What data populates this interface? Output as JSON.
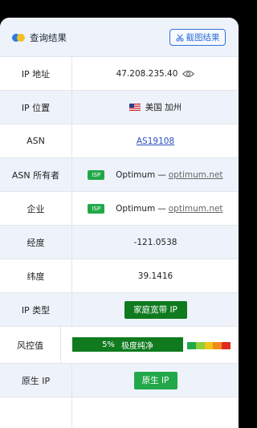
{
  "header": {
    "title": "查询结果",
    "screenshot_label": "截图结果"
  },
  "rows": {
    "ip_address": {
      "label": "IP 地址",
      "value": "47.208.235.40"
    },
    "ip_location": {
      "label": "IP 位置",
      "value": "美国 加州"
    },
    "asn": {
      "label": "ASN",
      "value": "AS19108"
    },
    "asn_owner": {
      "label": "ASN 所有者",
      "badge": "ISP",
      "name": "Optimum",
      "dash": "—",
      "domain": "optimum.net"
    },
    "company": {
      "label": "企业",
      "badge": "ISP",
      "name": "Optimum",
      "dash": "—",
      "domain": "optimum.net"
    },
    "longitude": {
      "label": "经度",
      "value": "-121.0538"
    },
    "latitude": {
      "label": "纬度",
      "value": "39.1416"
    },
    "ip_type": {
      "label": "IP 类型",
      "value": "家庭宽带 IP"
    },
    "risk": {
      "label": "风控值",
      "percent": "5%",
      "text": "极度纯净",
      "level": 0.05
    },
    "native_ip": {
      "label": "原生 IP",
      "value": "原生 IP"
    }
  },
  "colors": {
    "accent": "#2f6fd6",
    "dark_green": "#0f7a1e",
    "green": "#22a84a",
    "risk_scale": [
      "#22a84a",
      "#8fcf3a",
      "#f0c419",
      "#f08a1c",
      "#e02b20"
    ]
  },
  "icons": {
    "logo": "dual-circle-logo",
    "screenshot": "scissors-icon",
    "eye": "eye-icon",
    "flag": "us-flag-icon"
  }
}
